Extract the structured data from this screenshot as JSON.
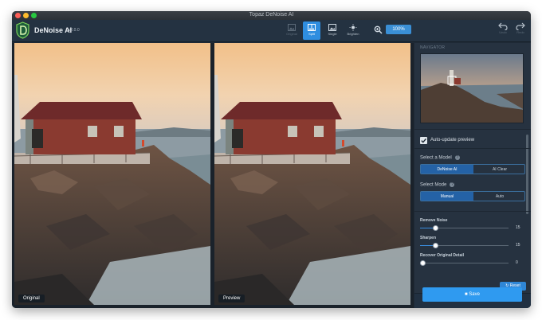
{
  "window": {
    "title": "Topaz DeNoise AI"
  },
  "app": {
    "name": "DeNoise AI",
    "version": "v2.0.0"
  },
  "toolbar": {
    "views": [
      {
        "label": "Original",
        "icon": "single-image-icon",
        "state": "dim"
      },
      {
        "label": "Split",
        "icon": "split-view-icon",
        "state": "active"
      },
      {
        "label": "Single",
        "icon": "single-image-icon",
        "state": "normal"
      },
      {
        "label": "Brighten",
        "icon": "sun-icon",
        "state": "normal"
      }
    ],
    "zoom": "100%",
    "undo_label": "Undo",
    "redo_label": "Redo"
  },
  "panes": {
    "left_label": "Original",
    "right_label": "Preview"
  },
  "sidebar": {
    "navigator_title": "NAVIGATOR",
    "auto_update_label": "Auto-update preview",
    "auto_update_checked": true,
    "model_label": "Select a Model",
    "model_options": [
      "DeNoise AI",
      "AI Clear"
    ],
    "model_selected": "DeNoise AI",
    "mode_label": "Select Mode",
    "mode_options": [
      "Manual",
      "Auto"
    ],
    "mode_selected": "Manual",
    "help_glyph": "?",
    "sliders": [
      {
        "label": "Remove Noise",
        "value": "15",
        "fraction": 0.17
      },
      {
        "label": "Sharpen",
        "value": "15",
        "fraction": 0.17
      },
      {
        "label": "Recover Original Detail",
        "value": "0",
        "fraction": 0.0
      }
    ],
    "reset_label": "Reset",
    "save_label": "Save"
  },
  "colors": {
    "accent": "#2f8ee0",
    "panel_bg": "#263240",
    "toolbar_bg": "#243241"
  }
}
